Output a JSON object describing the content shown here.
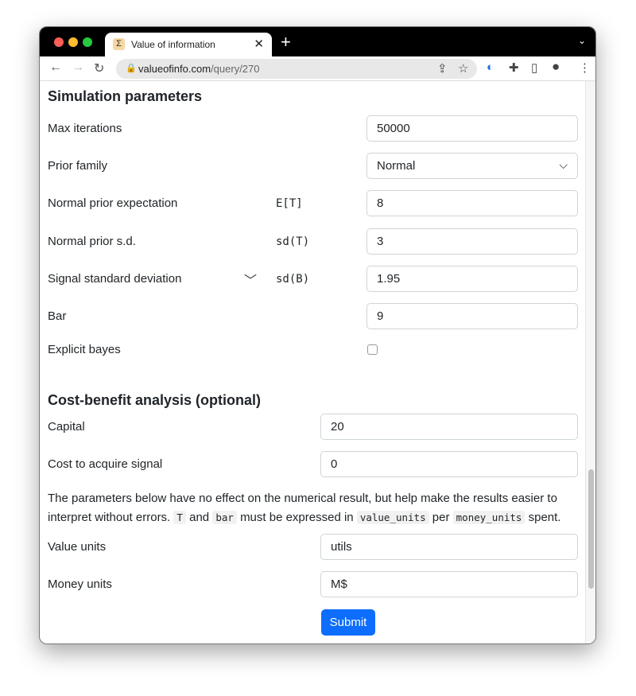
{
  "browser": {
    "tab_title": "Value of information",
    "url_host": "valueofinfo.com",
    "url_path": "/query/270"
  },
  "sim": {
    "heading": "Simulation parameters",
    "max_iter_label": "Max iterations",
    "max_iter": "50000",
    "prior_family_label": "Prior family",
    "prior_family": "Normal",
    "prior_exp_label": "Normal prior expectation",
    "prior_exp_math": "E[T]",
    "prior_exp": "8",
    "prior_sd_label": "Normal prior s.d.",
    "prior_sd_math": "sd(T)",
    "prior_sd": "3",
    "signal_sd_label": "Signal standard deviation",
    "signal_sd_math": "sd(B)",
    "signal_sd": "1.95",
    "bar_label": "Bar",
    "bar": "9",
    "explicit_label": "Explicit bayes",
    "explicit_checked": false
  },
  "cba": {
    "heading": "Cost-benefit analysis (optional)",
    "capital_label": "Capital",
    "capital": "20",
    "cost_label": "Cost to acquire signal",
    "cost": "0",
    "note_1": "The parameters below have no effect on the numerical result, but help make the results easier to interpret without errors.",
    "code_T": "T",
    "and": "and",
    "code_bar": "bar",
    "must": "must be expressed in",
    "code_value": "value_units",
    "per": "per",
    "code_money": "money_units",
    "spent": "spent.",
    "value_units_label": "Value units",
    "value_units": "utils",
    "money_units_label": "Money units",
    "money_units": "M$",
    "submit": "Submit"
  }
}
